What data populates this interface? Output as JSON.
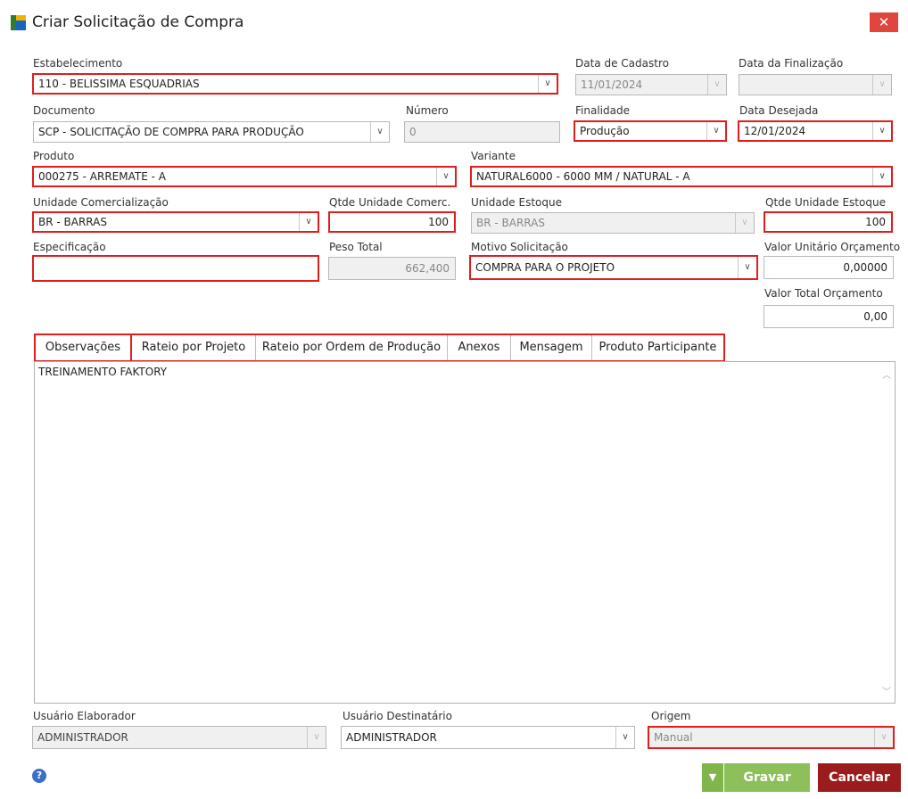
{
  "window": {
    "title": "Criar Solicitação de Compra",
    "close_glyph": "✕"
  },
  "estabelecimento": {
    "label": "Estabelecimento",
    "value": "110 - BELISSIMA ESQUADRIAS"
  },
  "data_cadastro": {
    "label": "Data de Cadastro",
    "value": "11/01/2024"
  },
  "data_finalizacao": {
    "label": "Data da Finalização",
    "value": ""
  },
  "documento": {
    "label": "Documento",
    "value": "SCP - SOLICITAÇÃO DE COMPRA PARA PRODUÇÃO"
  },
  "numero": {
    "label": "Número",
    "value": "0"
  },
  "finalidade": {
    "label": "Finalidade",
    "value": "Produção"
  },
  "data_desejada": {
    "label": "Data Desejada",
    "value": "12/01/2024"
  },
  "produto": {
    "label": "Produto",
    "value": "000275 - ARREMATE - A"
  },
  "variante": {
    "label": "Variante",
    "value": "NATURAL6000 - 6000 MM / NATURAL - A"
  },
  "unidade_comercializacao": {
    "label": "Unidade Comercialização",
    "value": "BR - BARRAS"
  },
  "qtde_unidade_comerc": {
    "label": "Qtde Unidade Comerc.",
    "value": "100"
  },
  "unidade_estoque": {
    "label": "Unidade Estoque",
    "value": "BR - BARRAS"
  },
  "qtde_unidade_estoque": {
    "label": "Qtde Unidade Estoque",
    "value": "100"
  },
  "especificacao": {
    "label": "Especificação",
    "value": ""
  },
  "peso_total": {
    "label": "Peso Total",
    "value": "662,400"
  },
  "motivo_solicitacao": {
    "label": "Motivo Solicitação",
    "value": "COMPRA PARA O PROJETO"
  },
  "valor_unitario": {
    "label": "Valor Unitário Orçamento",
    "value": "0,00000"
  },
  "valor_total": {
    "label": "Valor Total Orçamento",
    "value": "0,00"
  },
  "tabs": [
    {
      "label": "Observações",
      "active": true
    },
    {
      "label": "Rateio por Projeto"
    },
    {
      "label": "Rateio por Ordem de Produção"
    },
    {
      "label": "Anexos"
    },
    {
      "label": "Mensagem"
    },
    {
      "label": "Produto Participante"
    }
  ],
  "observacoes": {
    "text": "TREINAMENTO FAKTORY"
  },
  "usuario_elaborador": {
    "label": "Usuário Elaborador",
    "value": "ADMINISTRADOR"
  },
  "usuario_destinatario": {
    "label": "Usuário Destinatário",
    "value": "ADMINISTRADOR"
  },
  "origem": {
    "label": "Origem",
    "value": "Manual"
  },
  "buttons": {
    "dropdown_glyph": "▼",
    "save": "Gravar",
    "cancel": "Cancelar",
    "help_glyph": "?"
  },
  "colors": {
    "highlight": "#e01e1e",
    "save_green": "#8dc05a",
    "cancel_red": "#9b1c1c",
    "close_red": "#e0463d"
  },
  "icons": {
    "app": "app-logo-icon",
    "combo": "chevron-down-icon",
    "help": "help-icon"
  }
}
